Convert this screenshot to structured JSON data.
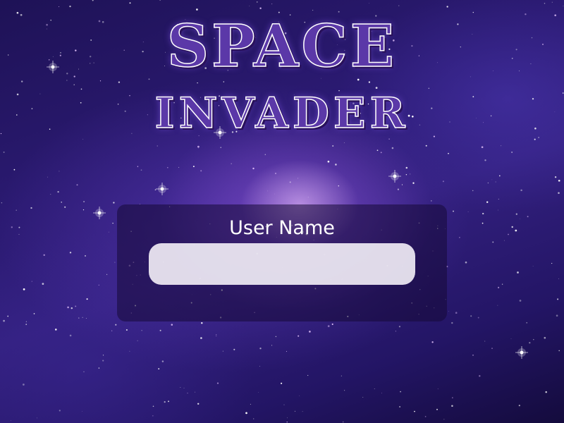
{
  "game": {
    "title_line1": "SPACE",
    "title_line2": "INVADER"
  },
  "login": {
    "label": "User Name",
    "input_value": "",
    "input_placeholder": ""
  },
  "colors": {
    "background_deep": "#1e1256",
    "nebula_purple": "#5b38a8",
    "title_fill": "#5b38a8",
    "title_outline": "#ffffff",
    "panel_bg": "#160a37",
    "input_bg": "#f0ecf5"
  }
}
